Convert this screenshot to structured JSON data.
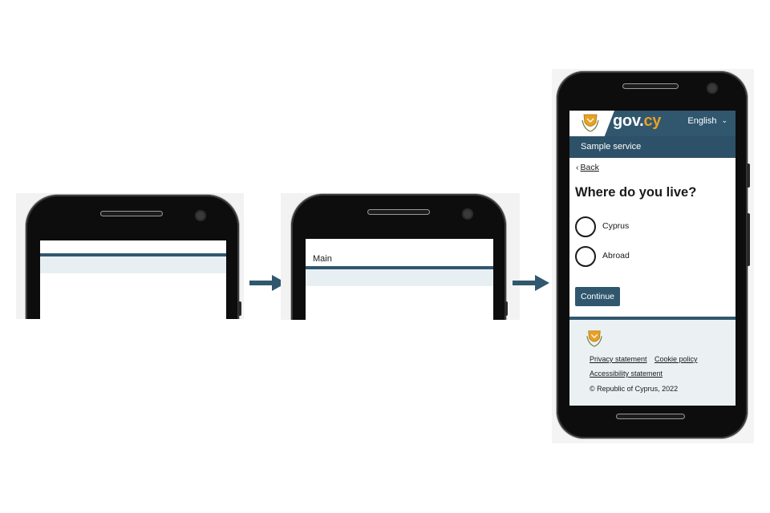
{
  "step2": {
    "header_text": "Main"
  },
  "step3": {
    "header": {
      "logo_text_gov": "gov.",
      "logo_text_cy": "cy",
      "language": "English"
    },
    "service_name": "Sample service",
    "back_label": "Back",
    "question": "Where do you live?",
    "options": [
      {
        "label": "Cyprus"
      },
      {
        "label": "Abroad"
      }
    ],
    "continue_label": "Continue",
    "footer": {
      "links": [
        "Privacy statement",
        "Cookie policy",
        "Accessibility statement"
      ],
      "copyright": "© Republic of Cyprus, 2022"
    }
  },
  "colors": {
    "brand_blue": "#31576F",
    "accent_orange": "#e8a122",
    "footer_bg": "#ebf1f3",
    "loading_band": "#e8eff2"
  },
  "icons": [
    "cyprus-emblem-icon",
    "chevron-down-icon",
    "back-chevron-icon",
    "arrow-right-icon"
  ]
}
